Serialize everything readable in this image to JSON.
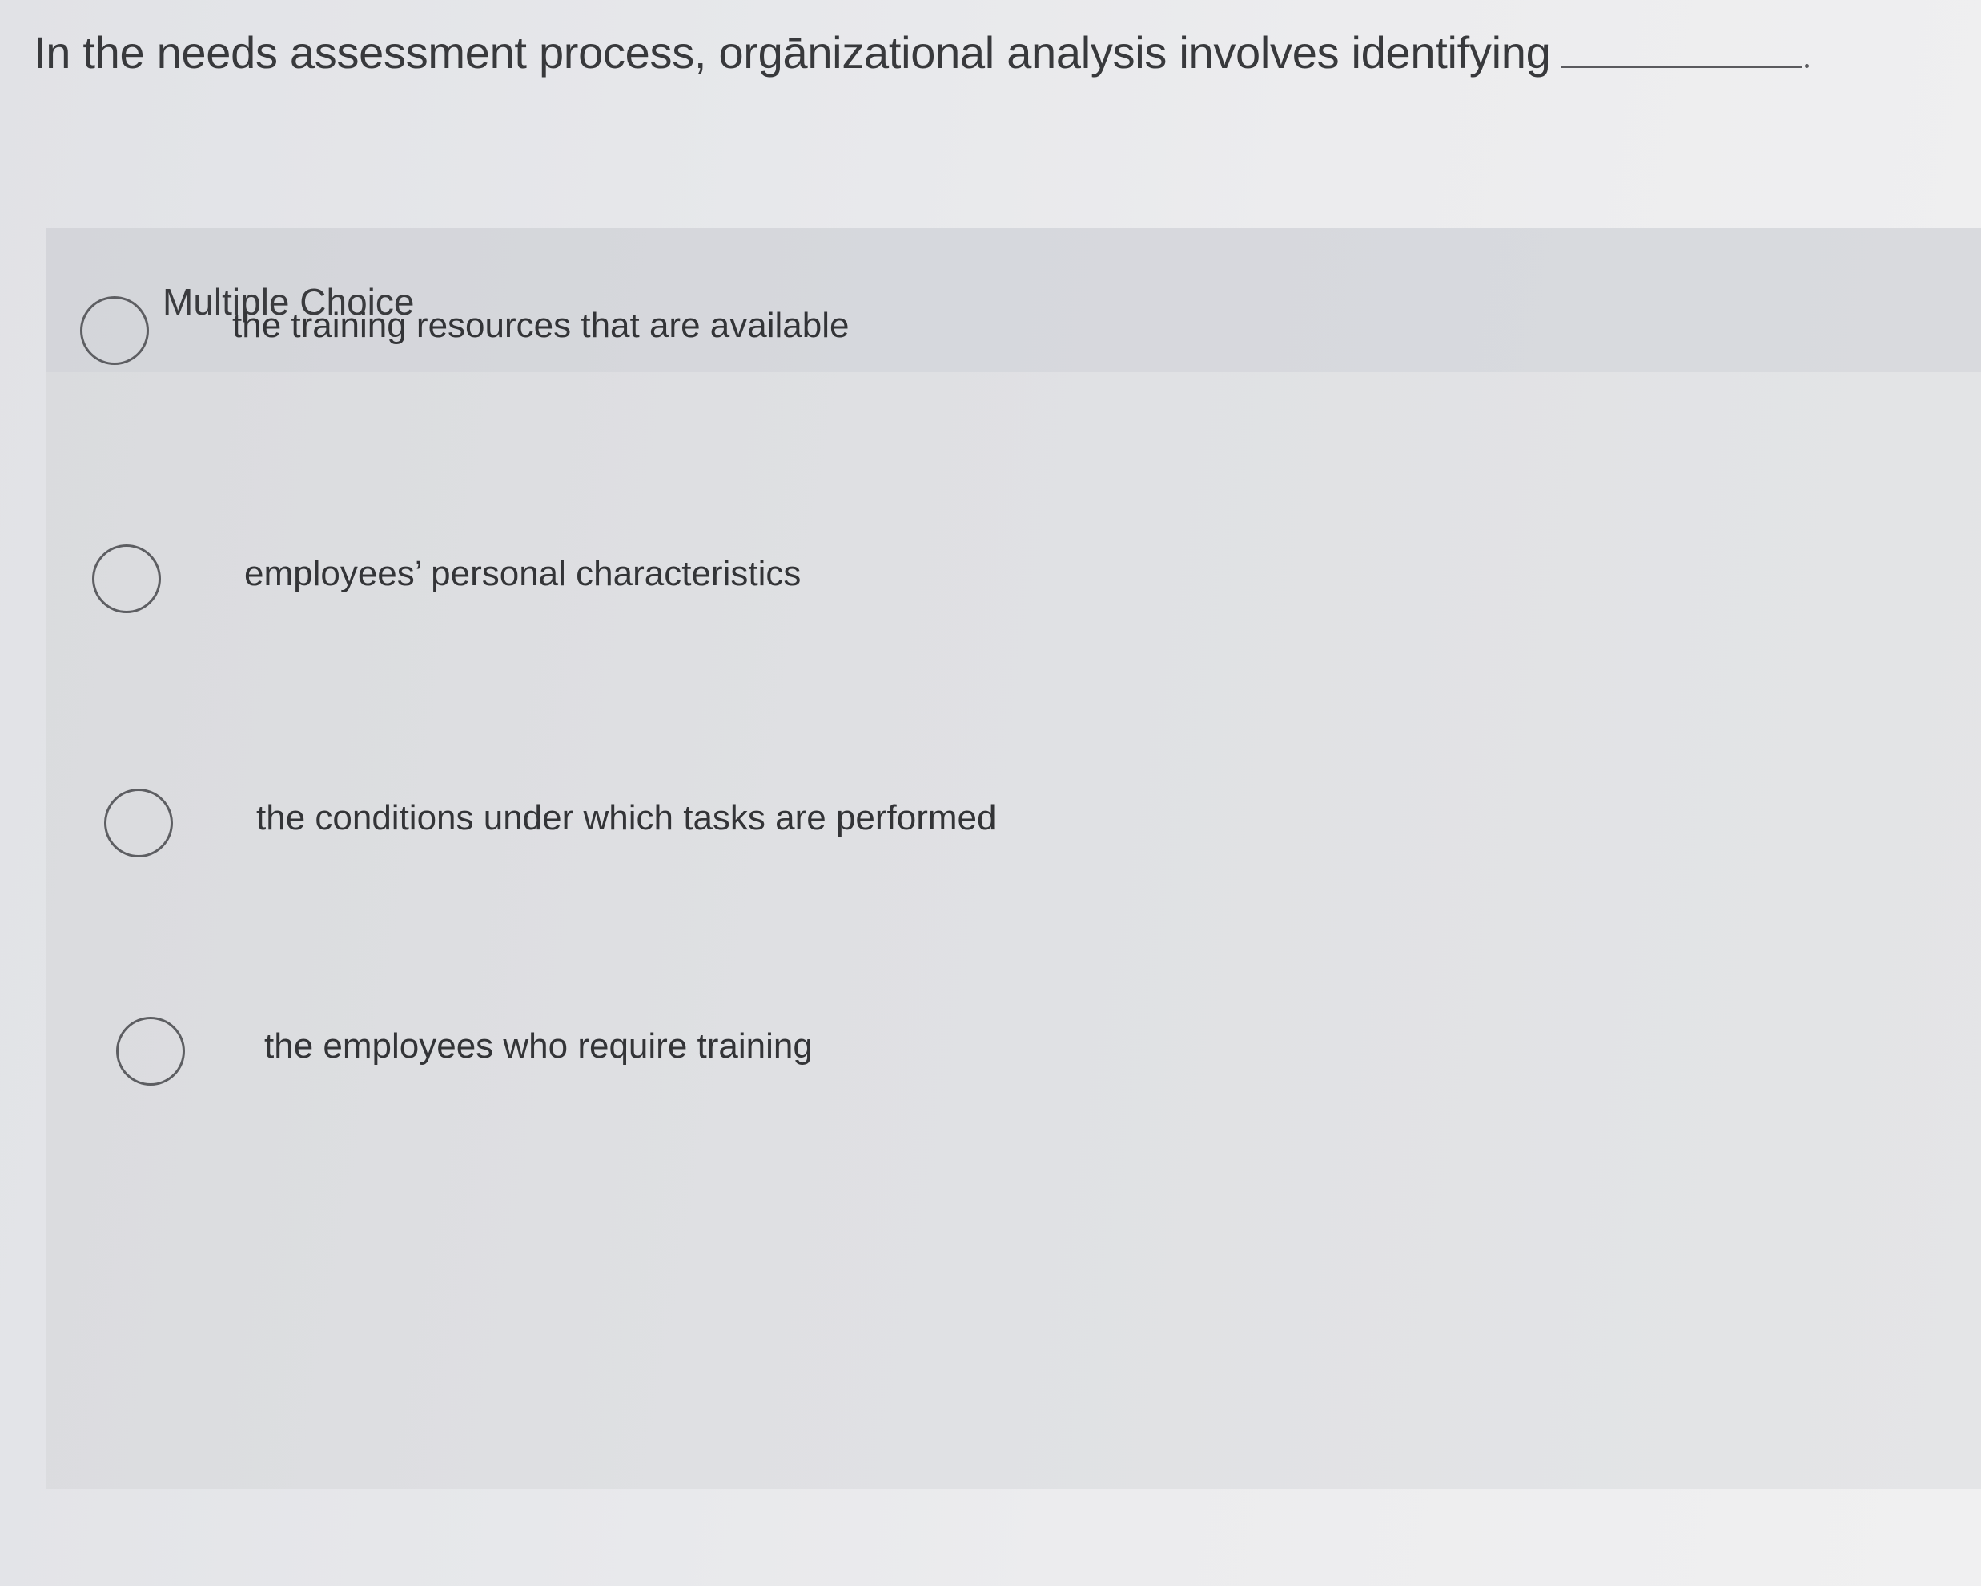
{
  "question": {
    "text": "In the needs assessment process, orgānizational analysis involves identifying"
  },
  "panel": {
    "title": "Multiple Choice"
  },
  "options": [
    {
      "label": "the training resources that are available",
      "selected": false
    },
    {
      "label": "employees’ personal characteristics",
      "selected": false
    },
    {
      "label": "the conditions under which tasks are performed",
      "selected": false
    },
    {
      "label": "the employees who require training",
      "selected": false
    }
  ]
}
